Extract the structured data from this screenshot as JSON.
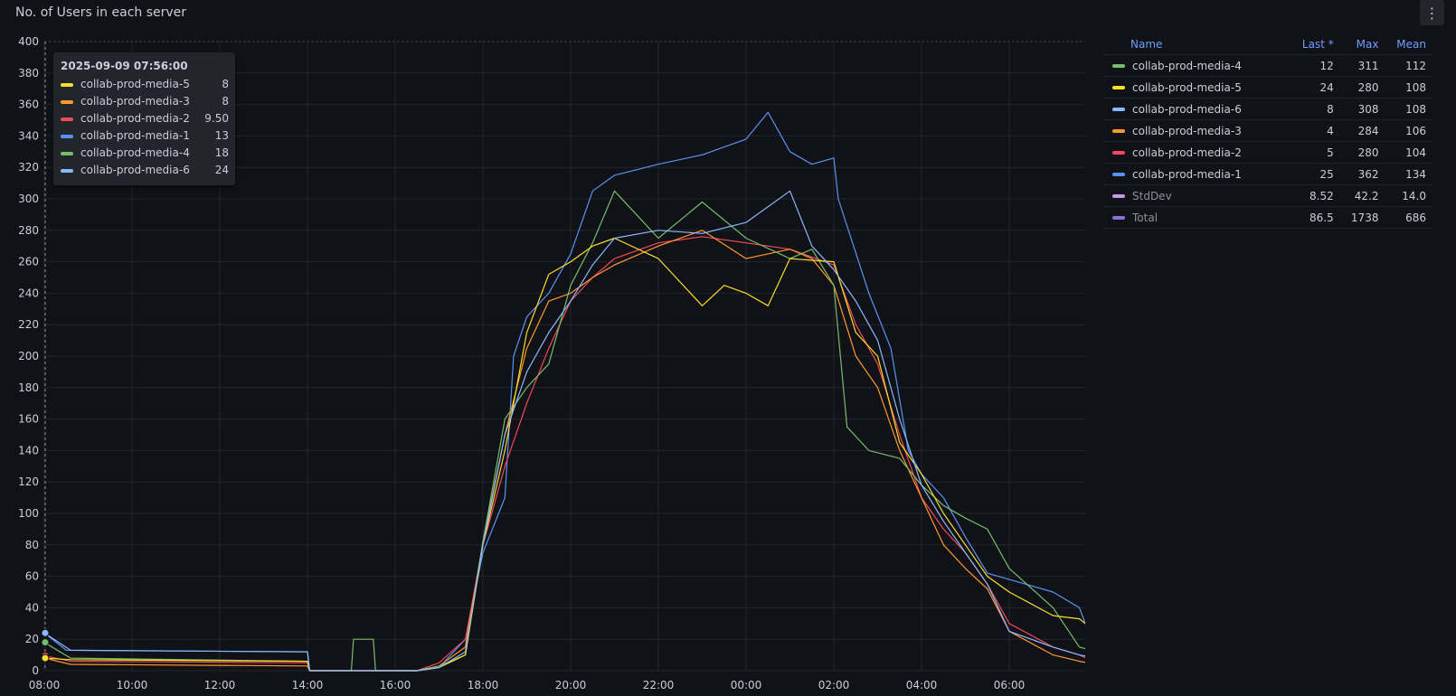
{
  "panel": {
    "title": "No. of Users in each server",
    "menu_icon": "kebab-menu-icon"
  },
  "tooltip": {
    "time": "2025-09-09 07:56:00",
    "rows": [
      {
        "name": "collab-prod-media-5",
        "value": "8",
        "color": "#fade2a"
      },
      {
        "name": "collab-prod-media-3",
        "value": "8",
        "color": "#ff9830"
      },
      {
        "name": "collab-prod-media-2",
        "value": "9.50",
        "color": "#f2495c"
      },
      {
        "name": "collab-prod-media-1",
        "value": "13",
        "color": "#5794f2"
      },
      {
        "name": "collab-prod-media-4",
        "value": "18",
        "color": "#73bf69"
      },
      {
        "name": "collab-prod-media-6",
        "value": "24",
        "color": "#8ab8ff"
      }
    ]
  },
  "legend": {
    "headers": {
      "name": "Name",
      "last": "Last *",
      "max": "Max",
      "mean": "Mean"
    },
    "rows": [
      {
        "name": "collab-prod-media-4",
        "last": "12",
        "max": "311",
        "mean": "112",
        "color": "#73bf69",
        "dim": false
      },
      {
        "name": "collab-prod-media-5",
        "last": "24",
        "max": "280",
        "mean": "108",
        "color": "#fade2a",
        "dim": false
      },
      {
        "name": "collab-prod-media-6",
        "last": "8",
        "max": "308",
        "mean": "108",
        "color": "#8ab8ff",
        "dim": false
      },
      {
        "name": "collab-prod-media-3",
        "last": "4",
        "max": "284",
        "mean": "106",
        "color": "#ff9830",
        "dim": false
      },
      {
        "name": "collab-prod-media-2",
        "last": "5",
        "max": "280",
        "mean": "104",
        "color": "#f2495c",
        "dim": false
      },
      {
        "name": "collab-prod-media-1",
        "last": "25",
        "max": "362",
        "mean": "134",
        "color": "#5794f2",
        "dim": false
      },
      {
        "name": "StdDev",
        "last": "8.52",
        "max": "42.2",
        "mean": "14.0",
        "color": "#ca95e5",
        "dim": true
      },
      {
        "name": "Total",
        "last": "86.5",
        "max": "1738",
        "mean": "686",
        "color": "#8f6fd6",
        "dim": true
      }
    ]
  },
  "chart_data": {
    "type": "line",
    "title": "No. of Users in each server",
    "ylim": [
      0,
      400
    ],
    "xlim": [
      0,
      24
    ],
    "grid": true,
    "legend_position": "right",
    "y_ticks": [
      "0",
      "20",
      "40",
      "60",
      "80",
      "100",
      "120",
      "140",
      "160",
      "180",
      "200",
      "220",
      "240",
      "260",
      "280",
      "300",
      "320",
      "340",
      "360",
      "380",
      "400"
    ],
    "x_ticks": [
      {
        "label": "08:00",
        "x": 0
      },
      {
        "label": "10:00",
        "x": 2
      },
      {
        "label": "12:00",
        "x": 4
      },
      {
        "label": "14:00",
        "x": 6
      },
      {
        "label": "16:00",
        "x": 8
      },
      {
        "label": "18:00",
        "x": 10
      },
      {
        "label": "20:00",
        "x": 12
      },
      {
        "label": "22:00",
        "x": 14
      },
      {
        "label": "00:00",
        "x": 16
      },
      {
        "label": "02:00",
        "x": 18
      },
      {
        "label": "04:00",
        "x": 20
      },
      {
        "label": "06:00",
        "x": 22
      }
    ],
    "series": [
      {
        "name": "collab-prod-media-1",
        "color": "#5794f2",
        "points": [
          [
            0,
            24
          ],
          [
            0.5,
            13
          ],
          [
            6,
            12
          ],
          [
            6.05,
            0
          ],
          [
            8.5,
            0
          ],
          [
            9,
            2
          ],
          [
            9.6,
            20
          ],
          [
            10,
            75
          ],
          [
            10.5,
            110
          ],
          [
            10.7,
            200
          ],
          [
            11,
            225
          ],
          [
            11.5,
            240
          ],
          [
            12,
            265
          ],
          [
            12.5,
            305
          ],
          [
            13,
            315
          ],
          [
            14,
            322
          ],
          [
            15,
            328
          ],
          [
            16,
            338
          ],
          [
            16.5,
            355
          ],
          [
            17,
            330
          ],
          [
            17.5,
            322
          ],
          [
            18,
            326
          ],
          [
            18.1,
            300
          ],
          [
            18.8,
            240
          ],
          [
            19.3,
            205
          ],
          [
            19.7,
            140
          ],
          [
            20,
            125
          ],
          [
            20.5,
            110
          ],
          [
            21,
            85
          ],
          [
            21.5,
            62
          ],
          [
            22,
            58
          ],
          [
            23,
            50
          ],
          [
            23.6,
            40
          ],
          [
            23.8,
            25
          ],
          [
            24,
            24
          ]
        ]
      },
      {
        "name": "collab-prod-media-2",
        "color": "#f2495c",
        "points": [
          [
            0,
            9.5
          ],
          [
            0.6,
            6
          ],
          [
            6,
            5
          ],
          [
            6.05,
            0
          ],
          [
            8.5,
            0
          ],
          [
            9,
            5
          ],
          [
            9.6,
            20
          ],
          [
            10,
            80
          ],
          [
            10.5,
            130
          ],
          [
            11,
            170
          ],
          [
            11.5,
            205
          ],
          [
            12,
            235
          ],
          [
            12.5,
            250
          ],
          [
            13,
            262
          ],
          [
            14,
            272
          ],
          [
            15,
            276
          ],
          [
            16,
            272
          ],
          [
            17,
            268
          ],
          [
            18,
            258
          ],
          [
            18.5,
            220
          ],
          [
            19,
            195
          ],
          [
            19.5,
            150
          ],
          [
            20,
            110
          ],
          [
            20.5,
            90
          ],
          [
            21,
            75
          ],
          [
            21.5,
            55
          ],
          [
            22,
            30
          ],
          [
            23,
            15
          ],
          [
            23.6,
            10
          ],
          [
            24,
            5
          ]
        ]
      },
      {
        "name": "collab-prod-media-3",
        "color": "#ff9830",
        "points": [
          [
            0,
            8
          ],
          [
            0.6,
            4
          ],
          [
            6,
            3
          ],
          [
            6.05,
            0
          ],
          [
            8.5,
            0
          ],
          [
            9,
            3
          ],
          [
            9.6,
            15
          ],
          [
            10,
            82
          ],
          [
            10.5,
            150
          ],
          [
            11,
            205
          ],
          [
            11.5,
            235
          ],
          [
            12,
            240
          ],
          [
            12.5,
            250
          ],
          [
            13,
            258
          ],
          [
            14,
            270
          ],
          [
            15,
            280
          ],
          [
            16,
            262
          ],
          [
            17,
            268
          ],
          [
            17.5,
            262
          ],
          [
            18,
            245
          ],
          [
            18.5,
            200
          ],
          [
            19,
            180
          ],
          [
            19.5,
            140
          ],
          [
            20,
            110
          ],
          [
            20.5,
            80
          ],
          [
            21,
            65
          ],
          [
            21.5,
            52
          ],
          [
            22,
            25
          ],
          [
            23,
            10
          ],
          [
            23.6,
            6
          ],
          [
            24,
            4
          ]
        ]
      },
      {
        "name": "collab-prod-media-4",
        "color": "#73bf69",
        "points": [
          [
            0,
            18
          ],
          [
            0.6,
            8
          ],
          [
            6,
            6
          ],
          [
            6.05,
            0
          ],
          [
            7,
            0
          ],
          [
            7.05,
            20
          ],
          [
            7.5,
            20
          ],
          [
            7.55,
            0
          ],
          [
            8.5,
            0
          ],
          [
            9,
            3
          ],
          [
            9.6,
            10
          ],
          [
            10,
            82
          ],
          [
            10.5,
            160
          ],
          [
            11,
            180
          ],
          [
            11.5,
            195
          ],
          [
            12,
            245
          ],
          [
            12.5,
            272
          ],
          [
            13,
            305
          ],
          [
            14,
            275
          ],
          [
            15,
            298
          ],
          [
            16,
            275
          ],
          [
            17,
            262
          ],
          [
            17.5,
            268
          ],
          [
            18,
            245
          ],
          [
            18.3,
            155
          ],
          [
            18.8,
            140
          ],
          [
            19.5,
            135
          ],
          [
            20,
            118
          ],
          [
            20.5,
            105
          ],
          [
            21,
            97
          ],
          [
            21.5,
            90
          ],
          [
            22,
            65
          ],
          [
            23,
            40
          ],
          [
            23.6,
            15
          ],
          [
            24,
            12
          ]
        ]
      },
      {
        "name": "collab-prod-media-5",
        "color": "#fade2a",
        "points": [
          [
            0,
            8
          ],
          [
            0.6,
            7
          ],
          [
            6,
            6
          ],
          [
            6.05,
            0
          ],
          [
            8.5,
            0
          ],
          [
            9,
            2
          ],
          [
            9.6,
            10
          ],
          [
            10,
            80
          ],
          [
            10.5,
            140
          ],
          [
            11,
            215
          ],
          [
            11.5,
            252
          ],
          [
            12,
            260
          ],
          [
            12.5,
            270
          ],
          [
            13,
            275
          ],
          [
            14,
            262
          ],
          [
            15,
            232
          ],
          [
            15.5,
            245
          ],
          [
            16,
            240
          ],
          [
            16.5,
            232
          ],
          [
            17,
            262
          ],
          [
            18,
            260
          ],
          [
            18.5,
            215
          ],
          [
            19,
            200
          ],
          [
            19.5,
            145
          ],
          [
            20,
            125
          ],
          [
            20.5,
            100
          ],
          [
            21,
            80
          ],
          [
            21.5,
            60
          ],
          [
            22,
            50
          ],
          [
            23,
            35
          ],
          [
            23.6,
            33
          ],
          [
            24,
            24
          ]
        ]
      },
      {
        "name": "collab-prod-media-6",
        "color": "#8ab8ff",
        "points": [
          [
            0,
            24
          ],
          [
            0.6,
            13
          ],
          [
            6,
            12
          ],
          [
            6.05,
            0
          ],
          [
            8.5,
            0
          ],
          [
            9,
            2
          ],
          [
            9.6,
            12
          ],
          [
            10,
            80
          ],
          [
            10.5,
            150
          ],
          [
            11,
            190
          ],
          [
            11.5,
            215
          ],
          [
            12,
            235
          ],
          [
            12.5,
            258
          ],
          [
            13,
            275
          ],
          [
            14,
            280
          ],
          [
            15,
            278
          ],
          [
            16,
            285
          ],
          [
            17,
            305
          ],
          [
            17.5,
            270
          ],
          [
            18,
            255
          ],
          [
            18.5,
            235
          ],
          [
            19,
            210
          ],
          [
            19.5,
            160
          ],
          [
            20,
            118
          ],
          [
            20.5,
            95
          ],
          [
            21,
            75
          ],
          [
            21.5,
            55
          ],
          [
            22,
            25
          ],
          [
            23,
            15
          ],
          [
            23.6,
            10
          ],
          [
            24,
            8
          ]
        ]
      }
    ]
  }
}
